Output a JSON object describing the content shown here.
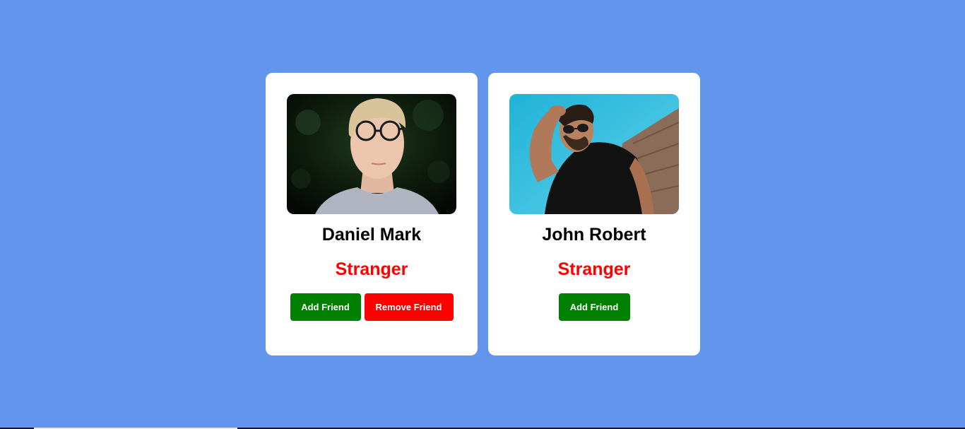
{
  "theme": {
    "background": "#6495ED",
    "card_background": "#ffffff",
    "add_color": "#008000",
    "remove_color": "#ff0000",
    "status_color": "#ff0000"
  },
  "cards": [
    {
      "name": "Daniel Mark",
      "status": "Stranger",
      "photo": "portrait-man-glasses",
      "buttons": {
        "add": "Add Friend",
        "remove": "Remove Friend"
      }
    },
    {
      "name": "John Robert",
      "status": "Stranger",
      "photo": "portrait-man-sunglasses",
      "buttons": {
        "add": "Add Friend"
      }
    }
  ]
}
